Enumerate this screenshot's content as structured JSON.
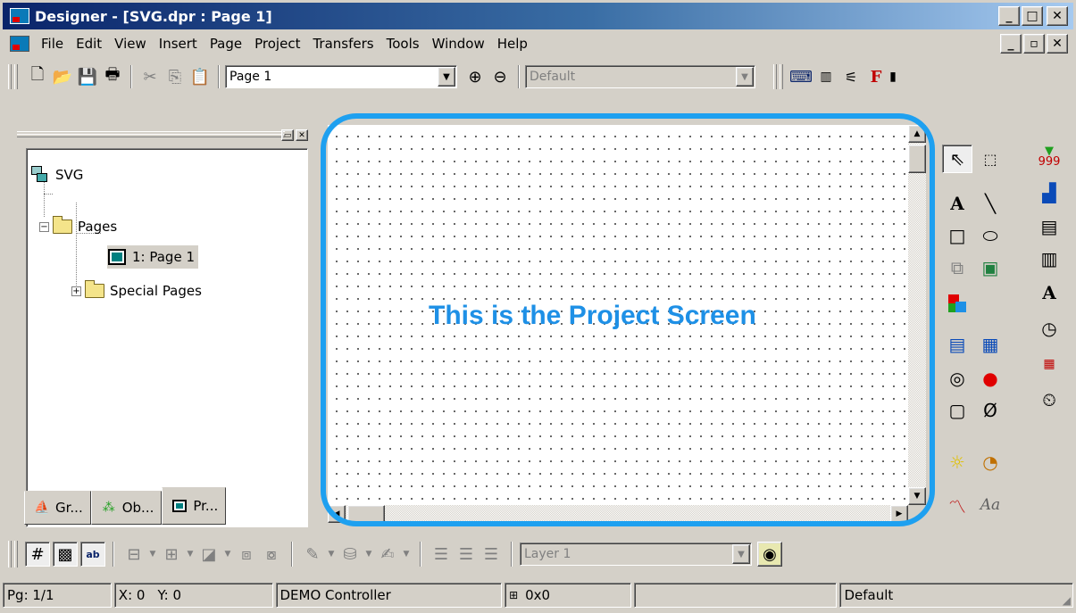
{
  "window": {
    "title": "Designer - [SVG.dpr : Page 1]"
  },
  "menu": [
    "File",
    "Edit",
    "View",
    "Insert",
    "Page",
    "Project",
    "Transfers",
    "Tools",
    "Window",
    "Help"
  ],
  "toolbar": {
    "page_combo_value": "Page 1",
    "style_combo_value": "Default",
    "layer_combo_value": "Layer 1"
  },
  "tree": {
    "root": "SVG",
    "pages": "Pages",
    "page1": "1: Page 1",
    "special": "Special Pages"
  },
  "panel_tabs": [
    "Gr...",
    "Ob...",
    "Pr..."
  ],
  "canvas": {
    "label": "This is the Project Screen"
  },
  "statusbar": {
    "page": "Pg: 1/1",
    "x": "X: 0",
    "y": "Y: 0",
    "controller": "DEMO Controller",
    "size": "0x0",
    "blank": "",
    "style": "Default"
  },
  "colors": {
    "highlight": "#1ea0f0",
    "label": "#1e90e6",
    "title_start": "#0a246a"
  }
}
